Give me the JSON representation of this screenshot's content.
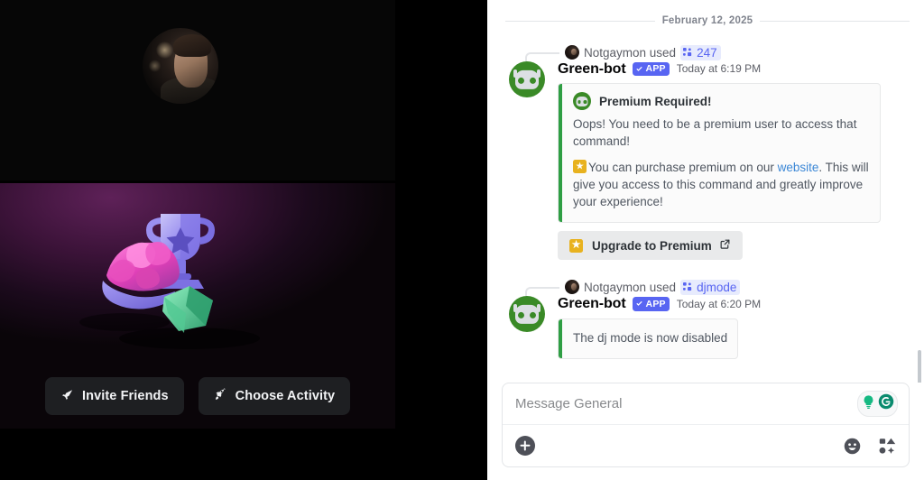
{
  "activity_panel": {
    "avatar_name": "user-video-avatar",
    "buttons": [
      {
        "label": "Invite Friends",
        "icon": "invite-friends-icon"
      },
      {
        "label": "Choose Activity",
        "icon": "rocket-icon"
      }
    ]
  },
  "chat": {
    "date_divider": "February 12, 2025",
    "messages": [
      {
        "reply_prefix": "Notgaymon used",
        "command": "247",
        "author": "Green-bot",
        "badge": "APP",
        "timestamp": "Today at 6:19 PM",
        "embed": {
          "title": "Premium Required!",
          "line1": "Oops! You need to be a premium user to access that command!",
          "line2_before": "You can purchase premium on our ",
          "link": "website",
          "line2_after": ". This will give you access to this command and greatly improve your experience!",
          "accent_color": "#2f9e44"
        },
        "button": {
          "label": "Upgrade to Premium",
          "icon": "external-link-icon"
        }
      },
      {
        "reply_prefix": "Notgaymon used",
        "command": "djmode",
        "author": "Green-bot",
        "badge": "APP",
        "timestamp": "Today at 6:20 PM",
        "embed_simple": "The dj mode is now disabled"
      }
    ]
  },
  "composer": {
    "placeholder": "Message General",
    "grammarly_icons": [
      "lightbulb-icon",
      "grammarly-logo-icon"
    ],
    "left_icon": "add-attachment-icon",
    "right_icons": [
      "emoji-icon",
      "apps-icon"
    ]
  },
  "colors": {
    "blurple": "#5865f2",
    "green": "#2f9e44",
    "link": "#3b87d6",
    "gold": "#e8b21f"
  }
}
